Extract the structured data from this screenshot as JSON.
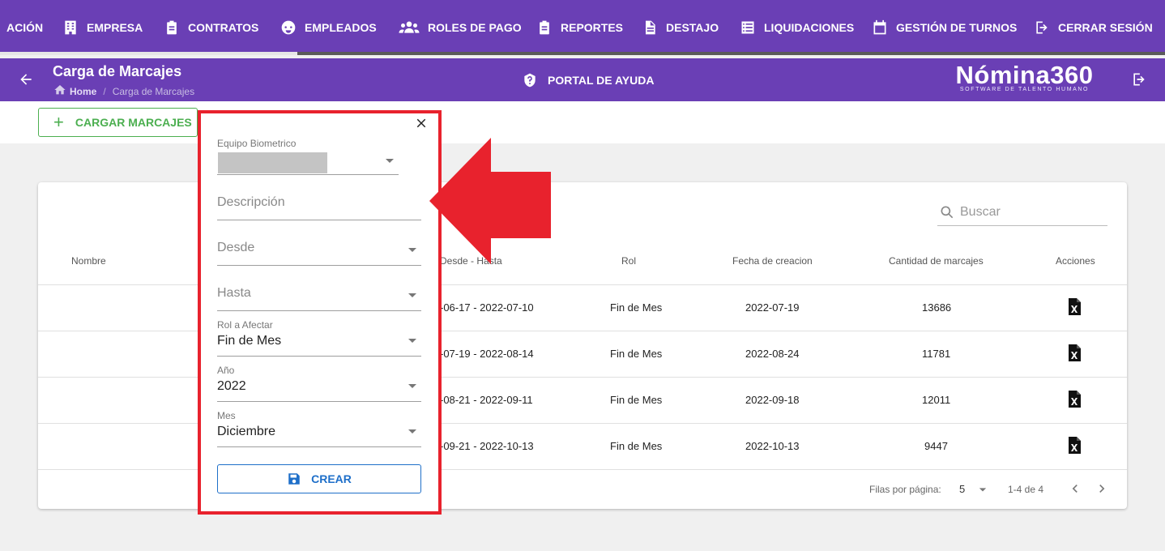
{
  "nav": {
    "items": [
      {
        "label": "ACIÓN",
        "icon": "none"
      },
      {
        "label": "EMPRESA",
        "icon": "building-icon"
      },
      {
        "label": "CONTRATOS",
        "icon": "clipboard-icon"
      },
      {
        "label": "EMPLEADOS",
        "icon": "face-icon"
      },
      {
        "label": "ROLES DE PAGO",
        "icon": "group-icon"
      },
      {
        "label": "REPORTES",
        "icon": "clipboard-icon"
      },
      {
        "label": "DESTAJO",
        "icon": "document-icon"
      },
      {
        "label": "LIQUIDACIONES",
        "icon": "list-icon"
      },
      {
        "label": "GESTIÓN DE TURNOS",
        "icon": "calendar-icon"
      },
      {
        "label": "CERRAR SESIÓN",
        "icon": "logout-icon"
      }
    ]
  },
  "header": {
    "title": "Carga de Marcajes",
    "breadcrumb_home": "Home",
    "breadcrumb_sep": "/",
    "breadcrumb_current": "Carga de Marcajes",
    "help_label": "PORTAL DE AYUDA",
    "logo_name": "Nómina360",
    "logo_tagline": "SOFTWARE DE TALENTO HUMANO"
  },
  "toolbar": {
    "add_label": "CARGAR MARCAJES",
    "add_symbol": "+"
  },
  "table": {
    "search_placeholder": "Buscar",
    "headers": {
      "nombre": "Nombre",
      "desde_hasta": "Desde - Hasta",
      "rol": "Rol",
      "fecha": "Fecha de creacion",
      "cantidad": "Cantidad de marcajes",
      "acciones": "Acciones"
    },
    "rows": [
      {
        "rango": "-06-17 - 2022-07-10",
        "rol": "Fin de Mes",
        "fecha": "2022-07-19",
        "cantidad": "13686"
      },
      {
        "rango": "-07-19 - 2022-08-14",
        "rol": "Fin de Mes",
        "fecha": "2022-08-24",
        "cantidad": "11781"
      },
      {
        "rango": "-08-21 - 2022-09-11",
        "rol": "Fin de Mes",
        "fecha": "2022-09-18",
        "cantidad": "12011"
      },
      {
        "rango": "-09-21 - 2022-10-13",
        "rol": "Fin de Mes",
        "fecha": "2022-10-13",
        "cantidad": "9447"
      }
    ],
    "pagination": {
      "rows_label": "Filas por página:",
      "rows_value": "5",
      "range": "1-4 de 4"
    }
  },
  "dialog": {
    "equipo_label": "Equipo Biometrico",
    "descripcion_placeholder": "Descripción",
    "desde_placeholder": "Desde",
    "hasta_placeholder": "Hasta",
    "rol_label": "Rol a Afectar",
    "rol_value": "Fin de Mes",
    "anio_label": "Año",
    "anio_value": "2022",
    "mes_label": "Mes",
    "mes_value": "Diciembre",
    "crear_label": "CREAR"
  },
  "colors": {
    "nav_bg": "#6a3fb5",
    "accent_green": "#4caf50",
    "accent_blue": "#1e6fc9",
    "highlight_red": "#e8222d"
  },
  "progress": {
    "fraction": 0.255
  }
}
